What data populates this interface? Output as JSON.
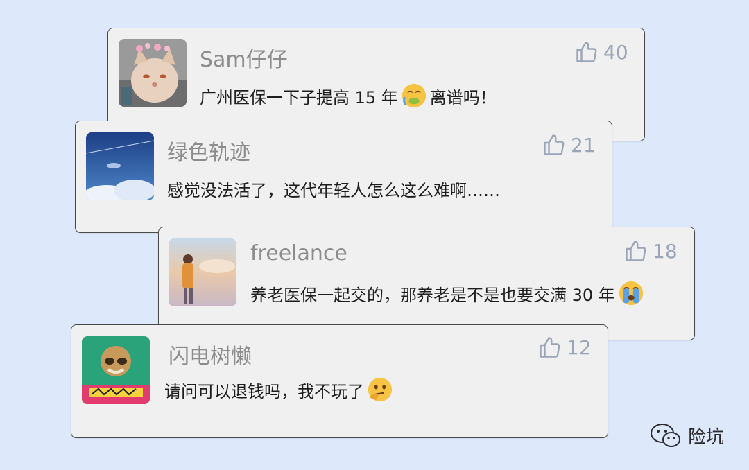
{
  "comments": [
    {
      "username": "Sam仔仔",
      "text_before": "广州医保一下子提高 15 年",
      "text_after": "离谱吗！",
      "likes": "40",
      "emoji": "nauseated-face-icon"
    },
    {
      "username": "绿色轨迹",
      "text_before": "感觉没法活了，这代年轻人怎么这么难啊……",
      "text_after": "",
      "likes": "21",
      "emoji": ""
    },
    {
      "username": "freelance",
      "text_before": "养老医保一起交的，那养老是不是也要交满 30 年",
      "text_after": "",
      "likes": "18",
      "emoji": "loudly-crying-face-icon"
    },
    {
      "username": "闪电树懒",
      "text_before": "请问可以退钱吗，我不玩了",
      "text_after": "",
      "likes": "12",
      "emoji": "thinking-face-icon"
    }
  ],
  "watermark": {
    "label": "险坑",
    "icon": "wechat-icon"
  },
  "colors": {
    "background": "#dde9fb",
    "card": "#f0f0f0",
    "username": "#8c8c8c",
    "like": "#9aa6b8"
  }
}
